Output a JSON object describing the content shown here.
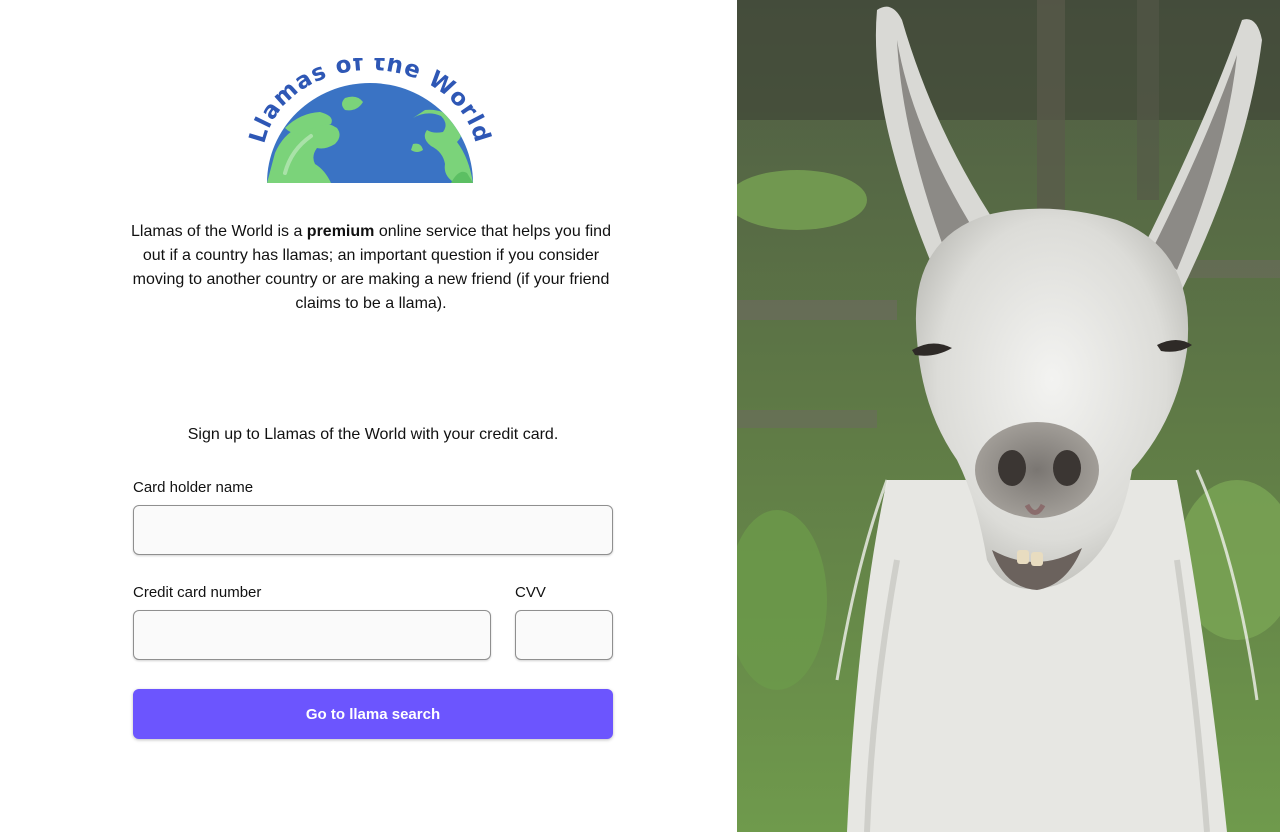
{
  "logo": {
    "arc_text": "Llamas of the World",
    "colors": {
      "ocean": "#3a73c4",
      "land": "#7bd37a",
      "text": "#2e57b5"
    }
  },
  "intro": {
    "part1": "Llamas of the World is a ",
    "bold": "premium",
    "part2": " online service that helps you find out if a country has llamas; an important question if you consider moving to another country or are making a new friend (if your friend claims to be a llama)."
  },
  "signup": {
    "text": "Sign up to Llamas of the World with your credit card."
  },
  "form": {
    "cardholder_label": "Card holder name",
    "cardholder_value": "",
    "card_number_label": "Credit card number",
    "card_number_value": "",
    "cvv_label": "CVV",
    "cvv_value": "",
    "submit_label": "Go to llama search"
  },
  "photo": {
    "subject": "white llama",
    "colors": {
      "accent": "#6c55fe"
    }
  }
}
